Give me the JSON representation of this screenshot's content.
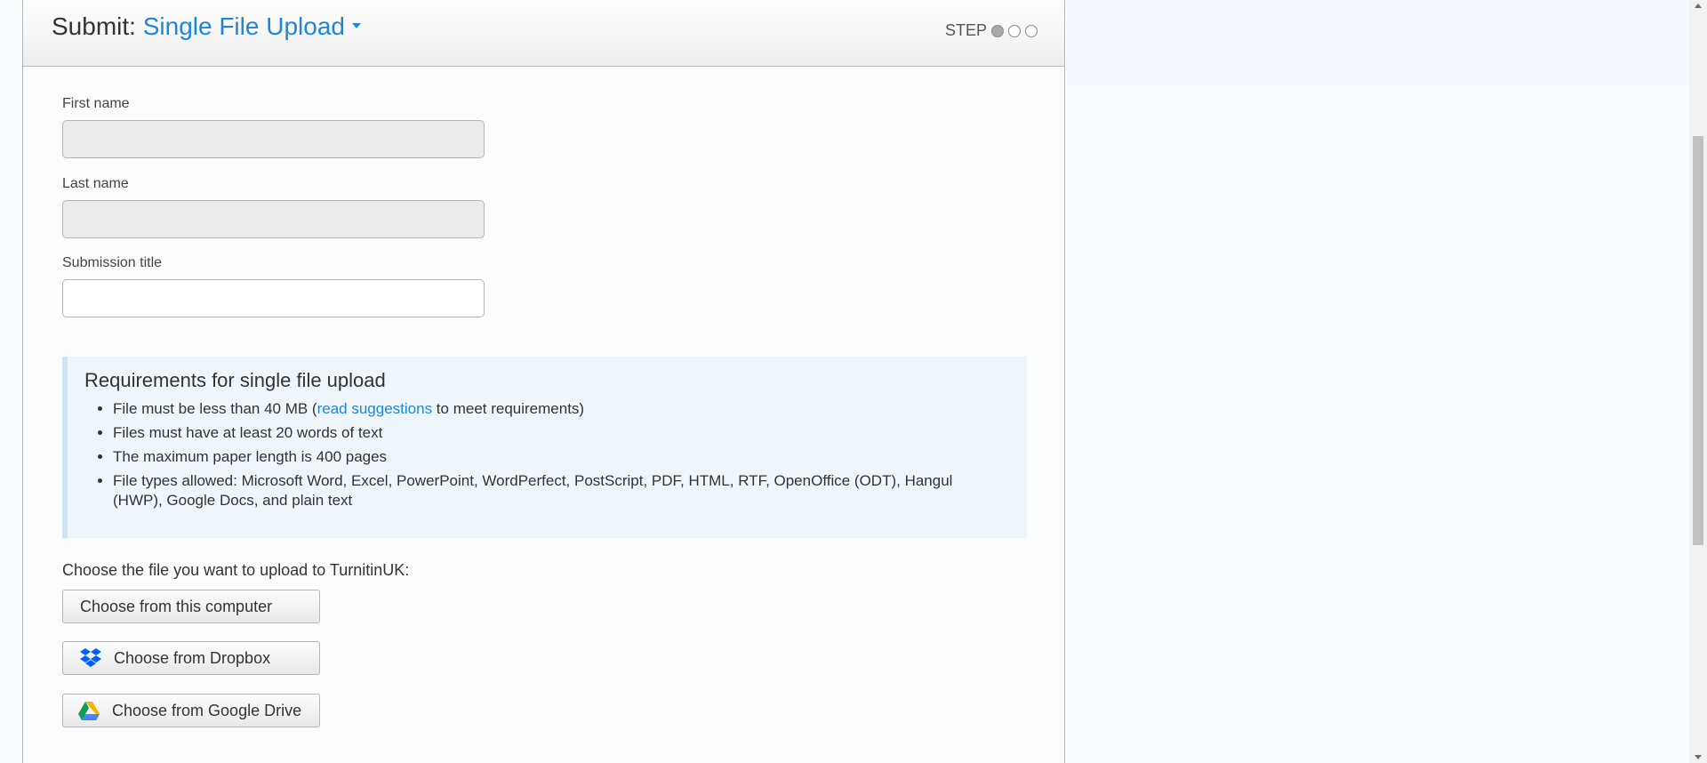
{
  "header": {
    "prefix": "Submit:",
    "mode_label": "Single File Upload",
    "step_label": "STEP",
    "steps_total": 3,
    "current_step": 1
  },
  "form": {
    "first_name_label": "First name",
    "first_name_value": "",
    "last_name_label": "Last name",
    "last_name_value": "",
    "submission_title_label": "Submission title",
    "submission_title_value": ""
  },
  "requirements": {
    "title": "Requirements for single file upload",
    "item1_before": "File must be less than 40 MB (",
    "item1_link": "read suggestions",
    "item1_after": " to meet requirements)",
    "item2": "Files must have at least 20 words of text",
    "item3": "The maximum paper length is 400 pages",
    "item4": "File types allowed: Microsoft Word, Excel, PowerPoint, WordPerfect, PostScript, PDF, HTML, RTF, OpenOffice (ODT), Hangul (HWP), Google Docs, and plain text"
  },
  "upload": {
    "choose_label": "Choose the file you want to upload to TurnitinUK:",
    "computer_button": "Choose from this computer",
    "dropbox_button": "Choose from Dropbox",
    "gdrive_button": "Choose from Google Drive"
  },
  "colors": {
    "link": "#1e88d8",
    "dropbox": "#0061fe",
    "gdrive_green": "#0f9d58",
    "gdrive_yellow": "#f4b400",
    "gdrive_blue": "#4285f4"
  }
}
